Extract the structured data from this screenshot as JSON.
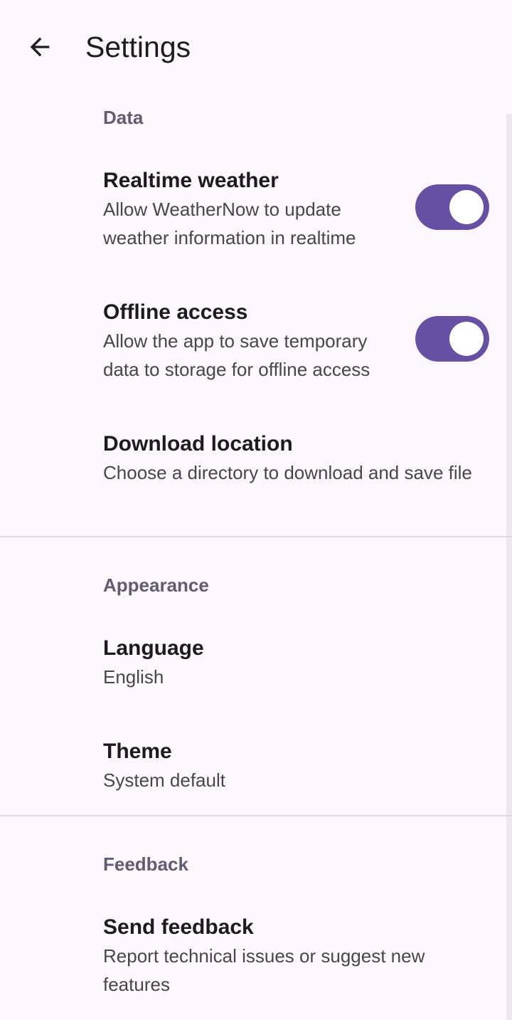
{
  "topbar": {
    "title": "Settings",
    "back_icon": "arrow-left-icon"
  },
  "colors": {
    "background": "#FDF7FD",
    "accent": "#6750A4",
    "section_header": "#625B71"
  },
  "sections": {
    "data": {
      "header": "Data",
      "realtime": {
        "title": "Realtime weather",
        "summary": "Allow WeatherNow to update weather information in realtime",
        "enabled": true
      },
      "offline": {
        "title": "Offline access",
        "summary": "Allow the app to save temporary data to storage for offline access",
        "enabled": true
      },
      "download": {
        "title": "Download location",
        "summary": "Choose a directory to download and save file"
      }
    },
    "appearance": {
      "header": "Appearance",
      "language": {
        "title": "Language",
        "summary": "English"
      },
      "theme": {
        "title": "Theme",
        "summary": "System default"
      }
    },
    "feedback": {
      "header": "Feedback",
      "send": {
        "title": "Send feedback",
        "summary": "Report technical issues or suggest new features"
      }
    }
  }
}
